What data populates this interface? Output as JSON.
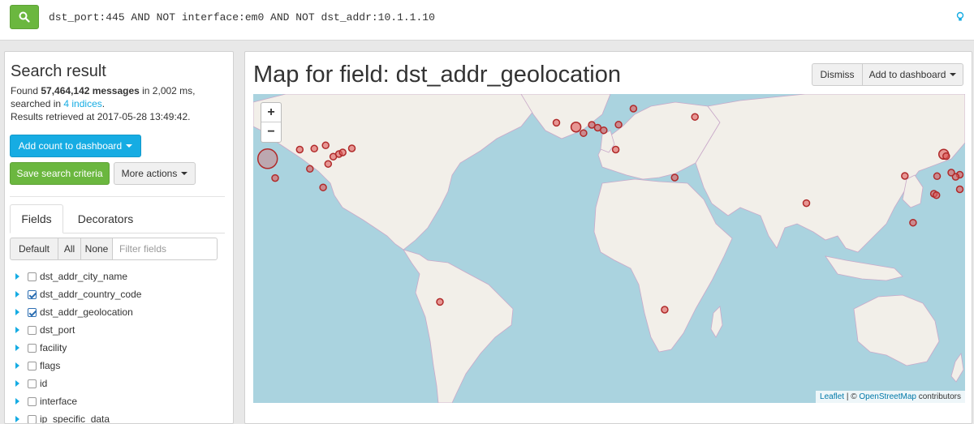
{
  "search": {
    "query": "dst_port:445 AND NOT interface:em0 AND NOT dst_addr:10.1.1.10",
    "button_icon": "search-icon",
    "help_icon": "lightbulb-icon"
  },
  "results": {
    "title": "Search result",
    "found_prefix": "Found ",
    "count": "57,464,142 messages",
    "found_suffix": " in 2,002 ms,",
    "searched_prefix": "searched in ",
    "indices": "4 indices",
    "searched_suffix": ".",
    "retrieved": "Results retrieved at 2017-05-28 13:49:42.",
    "add_count_label": "Add count to dashboard",
    "save_label": "Save search criteria",
    "more_actions_label": "More actions"
  },
  "tabs": {
    "fields": "Fields",
    "decorators": "Decorators"
  },
  "filter": {
    "default_label": "Default",
    "all_label": "All",
    "none_label": "None",
    "placeholder": "Filter fields"
  },
  "fields": [
    {
      "name": "dst_addr_city_name",
      "checked": false
    },
    {
      "name": "dst_addr_country_code",
      "checked": true
    },
    {
      "name": "dst_addr_geolocation",
      "checked": true
    },
    {
      "name": "dst_port",
      "checked": false
    },
    {
      "name": "facility",
      "checked": false
    },
    {
      "name": "flags",
      "checked": false
    },
    {
      "name": "id",
      "checked": false
    },
    {
      "name": "interface",
      "checked": false
    },
    {
      "name": "ip_specific_data",
      "checked": false
    }
  ],
  "map": {
    "title": "Map for field: dst_addr_geolocation",
    "dismiss_label": "Dismiss",
    "add_dashboard_label": "Add to dashboard",
    "zoom_in": "+",
    "zoom_out": "−",
    "attribution": {
      "leaflet": "Leaflet",
      "sep": " | © ",
      "osm": "OpenStreetMap",
      "suffix": " contributors"
    },
    "colors": {
      "water": "#aad3df",
      "land": "#f2efe9",
      "marker": "#e05a5a",
      "marker_stroke": "#b02a2a"
    },
    "markers": [
      {
        "lon": -122.4,
        "lat": 37.8,
        "size": "small"
      },
      {
        "lon": -118.2,
        "lat": 34.1,
        "size": "small"
      },
      {
        "lon": -112.0,
        "lat": 33.4,
        "size": "small"
      },
      {
        "lon": -95.4,
        "lat": 29.8,
        "size": "small"
      },
      {
        "lon": -97.8,
        "lat": 38.0,
        "size": "large"
      },
      {
        "lon": -84.4,
        "lat": 33.7,
        "size": "small"
      },
      {
        "lon": -80.2,
        "lat": 25.8,
        "size": "small"
      },
      {
        "lon": -87.6,
        "lat": 41.9,
        "size": "small"
      },
      {
        "lon": -83.0,
        "lat": 42.3,
        "size": "small"
      },
      {
        "lon": -79.4,
        "lat": 43.7,
        "size": "small"
      },
      {
        "lon": -77.0,
        "lat": 38.9,
        "size": "small"
      },
      {
        "lon": -75.2,
        "lat": 40.0,
        "size": "small"
      },
      {
        "lon": -74.0,
        "lat": 40.7,
        "size": "small"
      },
      {
        "lon": -71.1,
        "lat": 42.4,
        "size": "small"
      },
      {
        "lon": -78.6,
        "lat": 35.8,
        "size": "small"
      },
      {
        "lon": -43.2,
        "lat": -22.9,
        "size": "small"
      },
      {
        "lon": -6.3,
        "lat": 53.3,
        "size": "small"
      },
      {
        "lon": -0.1,
        "lat": 51.5,
        "size": "medium"
      },
      {
        "lon": 2.3,
        "lat": 48.9,
        "size": "small"
      },
      {
        "lon": 4.9,
        "lat": 52.4,
        "size": "small"
      },
      {
        "lon": 6.8,
        "lat": 51.2,
        "size": "small"
      },
      {
        "lon": 8.7,
        "lat": 50.1,
        "size": "small"
      },
      {
        "lon": 13.4,
        "lat": 52.5,
        "size": "small"
      },
      {
        "lon": 18.1,
        "lat": 59.3,
        "size": "small"
      },
      {
        "lon": 12.5,
        "lat": 41.9,
        "size": "small"
      },
      {
        "lon": 37.6,
        "lat": 55.8,
        "size": "small"
      },
      {
        "lon": 31.2,
        "lat": 30.0,
        "size": "small"
      },
      {
        "lon": 28.0,
        "lat": -26.2,
        "size": "small"
      },
      {
        "lon": 72.9,
        "lat": 19.1,
        "size": "small"
      },
      {
        "lon": 116.4,
        "lat": 39.9,
        "size": "medium"
      },
      {
        "lon": 117.2,
        "lat": 39.1,
        "size": "small"
      },
      {
        "lon": 121.5,
        "lat": 31.2,
        "size": "small"
      },
      {
        "lon": 120.2,
        "lat": 30.3,
        "size": "small"
      },
      {
        "lon": 113.3,
        "lat": 23.1,
        "size": "small"
      },
      {
        "lon": 114.1,
        "lat": 22.5,
        "size": "small"
      },
      {
        "lon": 121.5,
        "lat": 25.0,
        "size": "small"
      },
      {
        "lon": 104.1,
        "lat": 30.7,
        "size": "small"
      },
      {
        "lon": 114.3,
        "lat": 30.6,
        "size": "small"
      },
      {
        "lon": 118.8,
        "lat": 32.1,
        "size": "small"
      },
      {
        "lon": 126.9,
        "lat": 37.6,
        "size": "small"
      },
      {
        "lon": 129.0,
        "lat": 35.2,
        "size": "small"
      },
      {
        "lon": 139.7,
        "lat": 35.7,
        "size": "medium"
      },
      {
        "lon": 151.2,
        "lat": -33.9,
        "size": "small"
      },
      {
        "lon": 106.7,
        "lat": 10.8,
        "size": "small"
      },
      {
        "lon": 125.3,
        "lat": 43.9,
        "size": "small"
      }
    ]
  }
}
